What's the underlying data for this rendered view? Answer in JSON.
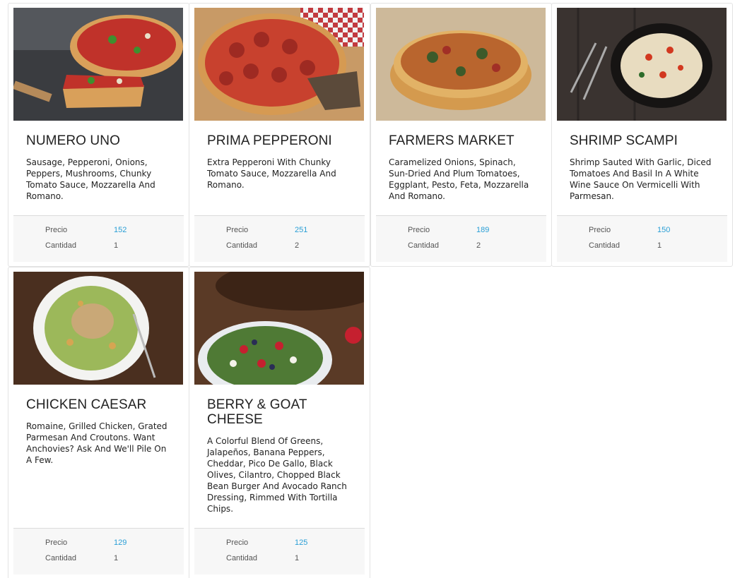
{
  "labels": {
    "price": "Precio",
    "quantity": "Cantidad"
  },
  "items": [
    {
      "name": "NUMERO UNO",
      "description": "Sausage, Pepperoni, Onions, Peppers, Mushrooms, Chunky Tomato Sauce, Mozzarella And Romano.",
      "price": "152",
      "quantity": "1",
      "image": "deep-dish-pizza-image"
    },
    {
      "name": "PRIMA PEPPERONI",
      "description": "Extra Pepperoni With Chunky Tomato Sauce, Mozzarella And Romano.",
      "price": "251",
      "quantity": "2",
      "image": "pepperoni-pizza-image"
    },
    {
      "name": "FARMERS MARKET",
      "description": "Caramelized Onions, Spinach, Sun-Dried And Plum Tomatoes, Eggplant, Pesto, Feta, Mozzarella And Romano.",
      "price": "189",
      "quantity": "2",
      "image": "veggie-pizza-image"
    },
    {
      "name": "SHRIMP SCAMPI",
      "description": "Shrimp Sauted With Garlic, Diced Tomatoes And Basil In A White Wine Sauce On Vermicelli With Parmesan.",
      "price": "150",
      "quantity": "1",
      "image": "shrimp-pasta-image"
    },
    {
      "name": "CHICKEN CAESAR",
      "description": "Romaine, Grilled Chicken, Grated Parmesan And Croutons. Want Anchovies? Ask And We'll Pile On A Few.",
      "price": "129",
      "quantity": "1",
      "image": "caesar-salad-image"
    },
    {
      "name": "BERRY & GOAT CHEESE",
      "description": "A Colorful Blend Of Greens, Jalapeños, Banana Peppers, Cheddar, Pico De Gallo, Black Olives, Cilantro, Chopped Black Bean Burger And Avocado Ranch Dressing, Rimmed With Tortilla Chips.",
      "price": "125",
      "quantity": "1",
      "image": "berry-salad-image"
    }
  ]
}
